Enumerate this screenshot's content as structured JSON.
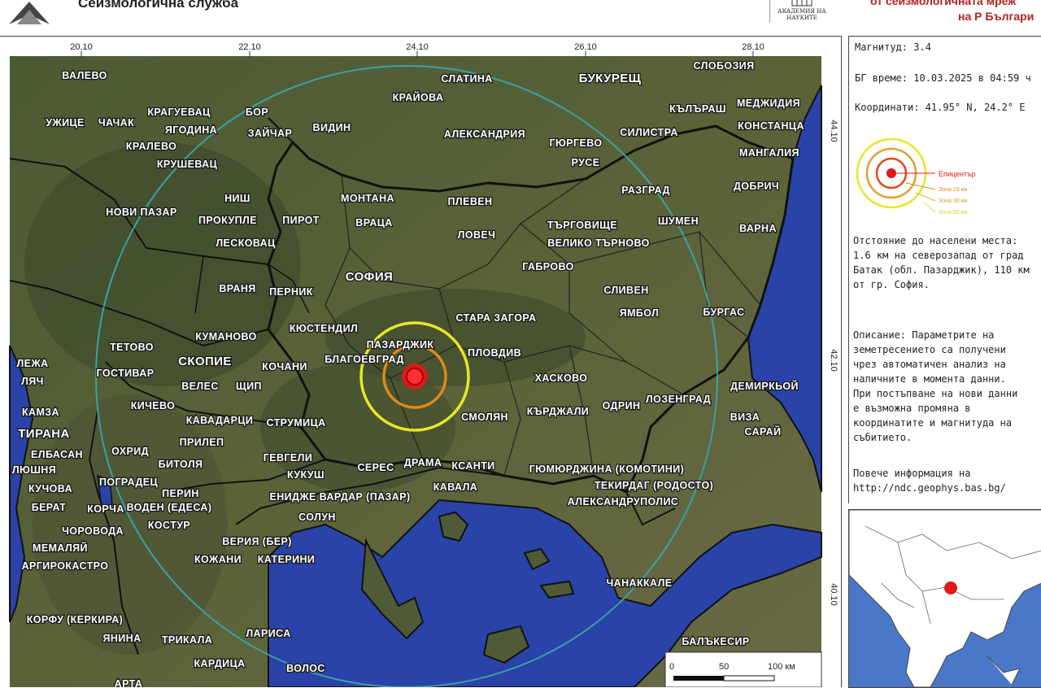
{
  "header": {
    "service_title": "Сеизмологична служба",
    "academy_text": "АКАДЕМИЯ НА НАУКИТЕ",
    "network_line1": "от сеизмологичната мреж",
    "network_line2": "на Р Българи"
  },
  "map": {
    "top_ticks": [
      "20.10",
      "22.10",
      "24.10",
      "26.10",
      "28.10"
    ],
    "right_ticks": [
      "44.10",
      "42.10",
      "40.10"
    ],
    "scale": [
      "0",
      "50",
      "100 км"
    ],
    "place_labels": [
      "ВАЛЕВО",
      "СЛАТИНА",
      "КРАЙОВА",
      "БУКУРЕЩ",
      "СЛОБОЗИЯ",
      "КРАГУЕВАЦ",
      "БОР",
      "УЖИЦЕ",
      "ЧАЧАК",
      "ЯГОДИНА",
      "ЗАЙЧАР",
      "ВИДИН",
      "АЛЕКСАНДРИЯ",
      "ГЮРГЕВО",
      "СИЛИСТРА",
      "КЪЛЪРАШ",
      "МЕДЖИДИЯ",
      "КОНСТАНЦА",
      "КРАЛЕВО",
      "КРУШЕВАЦ",
      "РУСЕ",
      "МАНГАЛИЯ",
      "НИШ",
      "МОНТАНА",
      "ПЛЕВЕН",
      "РАЗГРАД",
      "ДОБРИЧ",
      "НОВИ ПАЗАР",
      "ПРОКУПЛЕ",
      "ПИРОТ",
      "ВРАЦА",
      "ЛОВЕЧ",
      "ТЪРГОВИЩЕ",
      "ШУМЕН",
      "ВАРНА",
      "ЛЕСКОВАЦ",
      "ВЕЛИКО ТЪРНОВО",
      "ГАБРОВО",
      "СОФИЯ",
      "ВРАНЯ",
      "ПЕРНИК",
      "СЛИВЕН",
      "ЯМБОЛ",
      "БУРГАС",
      "СТАРА ЗАГОРА",
      "КЮСТЕНДИЛ",
      "ПАЗАРДЖИК",
      "КУМАНОВО",
      "БЛАГОЕВГРАД",
      "ТЕТОВО",
      "СКОПИЕ",
      "КОЧАНИ",
      "ПЛОВДИВ",
      "ЛЕЖА",
      "ГОСТИВАР",
      "ВЕЛЕС",
      "ЩИП",
      "ХАСКОВО",
      "ДЕМИРКЬОЙ",
      "ЛЯЧ",
      "КИЧЕВО",
      "ОДРИН",
      "ЛОЗЕНГРАД",
      "КАМЗА",
      "КАВАДАРЦИ",
      "СТРУМИЦА",
      "СМОЛЯН",
      "КЪРДЖАЛИ",
      "ВИЗА",
      "ТИРАНА",
      "ПРИЛЕП",
      "САРАЙ",
      "ЕЛБАСАН",
      "ОХРИД",
      "ГЕВГЕЛИ",
      "ДРАМА",
      "КСАНТИ",
      "ЛЮШНЯ",
      "БИТОЛЯ",
      "СЕРЕС",
      "ГЮМЮРДЖИНА (КОМОТИНИ)",
      "ПОГРАДЕЦ",
      "КУКУШ",
      "ТЕКИРДАГ (РОДОСТО)",
      "КУЧОВА",
      "ПЕРИН",
      "ЕНИДЖЕ ВАРДАР (ПАЗАР)",
      "КАВАЛА",
      "БЕРАТ",
      "КОРЧА",
      "ВОДЕН (ЕДЕСА)",
      "АЛЕКСАНДРУПОЛИС",
      "ЧОРОВОДА",
      "КОСТУР",
      "СОЛУН",
      "МЕМАЛЯЙ",
      "ВЕРИЯ (БЕР)",
      "АРГИРОКАСТРО",
      "КОЖАНИ",
      "КАТЕРИНИ",
      "ЧАНАККАЛЕ",
      "КОРФУ (КЕРКИРА)",
      "ЯНИНА",
      "ЛАРИСА",
      "ТРИКАЛА",
      "БАЛЪКЕСИР",
      "КАРДИЦА",
      "ВОЛОС",
      "АРТА"
    ]
  },
  "info": {
    "magnitude": "Магнитуд: 3.4",
    "bg_time": "БГ време: 10.03.2025 в 04:59 ч",
    "coordinates": "Координати: 41.95° N, 24.2° E",
    "legend": [
      "Епицентър",
      "Зона 10 км",
      "Зона 30 км",
      "Зона 50 км"
    ],
    "distance_lines": [
      "Отстояние до населени места:",
      "1.6 км на северозапад от град",
      "Батак (обл. Пазарджик), 110 км",
      "от гр. София."
    ],
    "description_lines": [
      "Описание: Параметрите на",
      "земетресението са получени",
      "чрез автоматичен анализ на",
      "наличните в момента данни.",
      "При постъпване на нови данни",
      "е възможна промяна в",
      "координатите и магнитуда на",
      "събитието."
    ],
    "more_info_lines": [
      "Повече информация на",
      "http://ndc.geophys.bas.bg/"
    ]
  },
  "colors": {
    "epicenter": "#e01818",
    "zone10": "#e08a1a",
    "zone30": "#e6e628",
    "zone50": "#3aa0a8",
    "sea": "#2a43a8",
    "land": "#4f5a36"
  }
}
